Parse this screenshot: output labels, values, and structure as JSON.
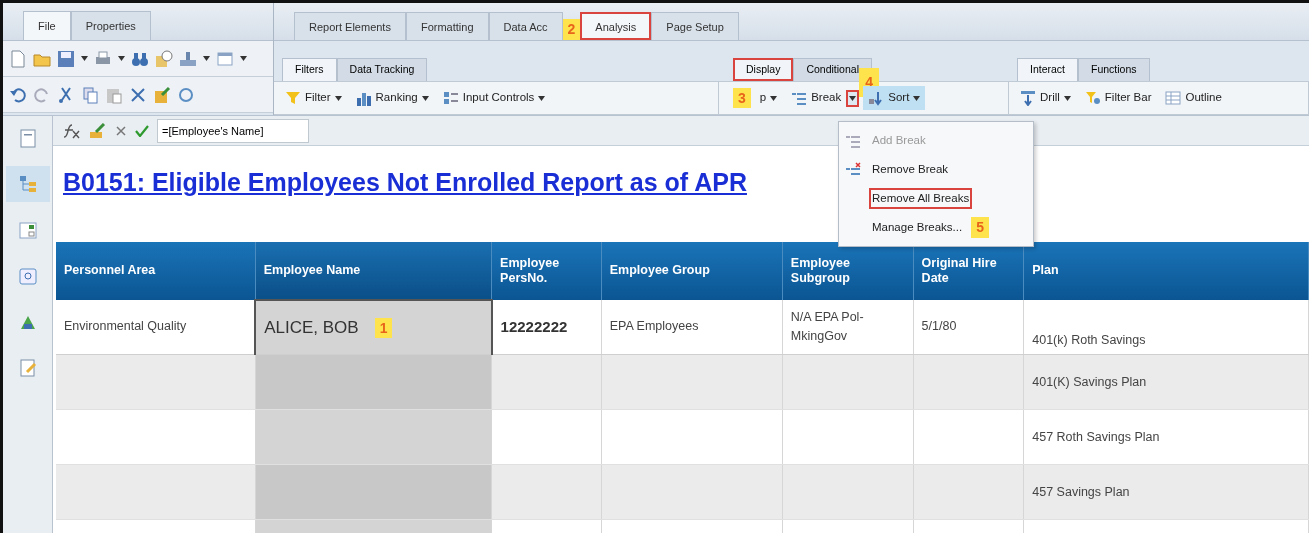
{
  "left_tabs": [
    {
      "label": "File",
      "selected": true
    },
    {
      "label": "Properties",
      "selected": false
    }
  ],
  "main_tabs": [
    {
      "label": "Report Elements",
      "selected": false,
      "highlighted": false
    },
    {
      "label": "Formatting",
      "selected": false,
      "highlighted": false
    },
    {
      "label": "Data Acc",
      "selected": false,
      "highlighted": false
    },
    {
      "label": "Analysis",
      "selected": true,
      "highlighted": true,
      "callout": "2"
    },
    {
      "label": "Page Setup",
      "selected": false,
      "highlighted": false
    }
  ],
  "subtab_groups": [
    {
      "tabs": [
        {
          "label": "Filters",
          "selected": true,
          "highlighted": false
        },
        {
          "label": "Data Tracking",
          "selected": false,
          "highlighted": false
        }
      ]
    },
    {
      "tabs": [
        {
          "label": "Display",
          "selected": true,
          "highlighted": true
        },
        {
          "label": "Conditional",
          "selected": false,
          "highlighted": false
        }
      ]
    },
    {
      "tabs": [
        {
          "label": "Interact",
          "selected": true,
          "highlighted": false
        },
        {
          "label": "Functions",
          "selected": false,
          "highlighted": false
        }
      ]
    }
  ],
  "toolbar_groups": [
    {
      "buttons": [
        {
          "kind": "filter",
          "label": "Filter",
          "dropdown": true,
          "pressed": false
        },
        {
          "kind": "ranking",
          "label": "Ranking",
          "dropdown": true,
          "pressed": false
        },
        {
          "kind": "input",
          "label": "Input Controls",
          "dropdown": true,
          "pressed": false
        }
      ]
    },
    {
      "buttons": [
        {
          "kind": "plain",
          "label": "p",
          "dropdown": true,
          "pressed": false,
          "callout": "3"
        },
        {
          "kind": "break",
          "label": "Break",
          "dropdown": true,
          "split": true,
          "split_highlighted": true,
          "pressed": false,
          "callout": "4"
        },
        {
          "kind": "sort",
          "label": "Sort",
          "dropdown": true,
          "pressed": true
        }
      ]
    },
    {
      "buttons": [
        {
          "kind": "drill",
          "label": "Drill",
          "dropdown": true,
          "pressed": false
        },
        {
          "kind": "filterbar",
          "label": "Filter Bar",
          "dropdown": false,
          "pressed": false
        },
        {
          "kind": "outline",
          "label": "Outline",
          "dropdown": false,
          "pressed": false
        }
      ]
    }
  ],
  "sidebar_items": [
    {
      "selected": false
    },
    {
      "selected": true
    },
    {
      "selected": false
    },
    {
      "selected": false
    },
    {
      "selected": false
    },
    {
      "selected": false
    }
  ],
  "formula": {
    "value": "=[Employee's Name]"
  },
  "report_title": "B0151: Eligible Employees Not Enrolled Report as of APR",
  "break_menu": [
    {
      "label": "Add Break",
      "disabled": true,
      "highlighted": false
    },
    {
      "label": "Remove Break",
      "disabled": false,
      "highlighted": false
    },
    {
      "label": "Remove All Breaks",
      "disabled": false,
      "highlighted": true
    },
    {
      "label": "Manage Breaks...",
      "disabled": false,
      "highlighted": false,
      "callout": "5"
    }
  ],
  "table": {
    "columns": [
      {
        "label": "Personnel Area",
        "selected": false
      },
      {
        "label": "Employee Name",
        "selected": true
      },
      {
        "label": "Employee PersNo.",
        "selected": false
      },
      {
        "label": "Employee Group",
        "selected": false
      },
      {
        "label": "Employee Subgroup",
        "selected": false
      },
      {
        "label": "Original Hire Date",
        "selected": false
      },
      {
        "label": "Plan",
        "selected": false
      }
    ],
    "rows": [
      {
        "selected": true,
        "callout": "1",
        "cells": [
          "Environmental Quality",
          "ALICE, BOB",
          "12222222",
          "EPA Employees",
          "N/A EPA Pol-MkingGov",
          "5/1/80",
          "401(k) Roth Savings"
        ]
      },
      {
        "selected": false,
        "cells": [
          null,
          null,
          null,
          null,
          null,
          null,
          "401(K) Savings Plan"
        ]
      },
      {
        "selected": false,
        "cells": [
          null,
          null,
          null,
          null,
          null,
          null,
          "457 Roth Savings Plan"
        ]
      },
      {
        "selected": false,
        "cells": [
          null,
          null,
          null,
          null,
          null,
          null,
          "457 Savings Plan"
        ]
      },
      {
        "selected": false,
        "cells": [
          null,
          null,
          null,
          null,
          null,
          null,
          null
        ]
      }
    ]
  }
}
